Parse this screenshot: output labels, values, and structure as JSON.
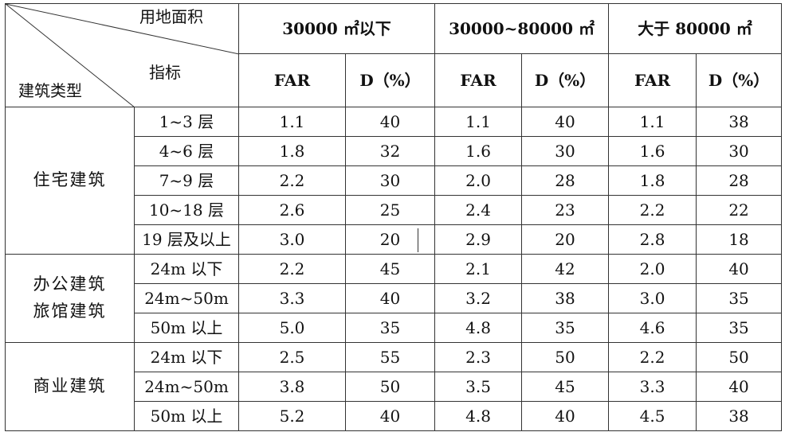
{
  "header": {
    "corner_top": "用地面积",
    "corner_mid": "指标",
    "corner_bottom": "建筑类型",
    "areas": [
      "30000 ㎡以下",
      "30000~80000 ㎡",
      "大于 80000 ㎡"
    ],
    "metrics": [
      "FAR",
      "D（%）"
    ]
  },
  "groups": [
    {
      "category_lines": [
        "住宅建筑"
      ],
      "rows": [
        {
          "sub": "1~3 层",
          "values": [
            "1.1",
            "40",
            "1.1",
            "40",
            "1.1",
            "38"
          ]
        },
        {
          "sub": "4~6 层",
          "values": [
            "1.8",
            "32",
            "1.6",
            "30",
            "1.6",
            "30"
          ]
        },
        {
          "sub": "7~9 层",
          "values": [
            "2.2",
            "30",
            "2.0",
            "28",
            "1.8",
            "28"
          ]
        },
        {
          "sub": "10~18 层",
          "values": [
            "2.6",
            "25",
            "2.4",
            "23",
            "2.2",
            "22"
          ]
        },
        {
          "sub": "19 层及以上",
          "values": [
            "3.0",
            "20",
            "2.9",
            "20",
            "2.8",
            "18"
          ]
        }
      ]
    },
    {
      "category_lines": [
        "办公建筑",
        "旅馆建筑"
      ],
      "rows": [
        {
          "sub": "24m 以下",
          "values": [
            "2.2",
            "45",
            "2.1",
            "42",
            "2.0",
            "40"
          ]
        },
        {
          "sub": "24m~50m",
          "values": [
            "3.3",
            "40",
            "3.2",
            "38",
            "3.0",
            "35"
          ]
        },
        {
          "sub": "50m 以上",
          "values": [
            "5.0",
            "35",
            "4.8",
            "35",
            "4.6",
            "35"
          ]
        }
      ]
    },
    {
      "category_lines": [
        "商业建筑"
      ],
      "rows": [
        {
          "sub": "24m 以下",
          "values": [
            "2.5",
            "55",
            "2.3",
            "50",
            "2.2",
            "50"
          ]
        },
        {
          "sub": "24m~50m",
          "values": [
            "3.8",
            "50",
            "3.5",
            "45",
            "3.3",
            "40"
          ]
        },
        {
          "sub": "50m 以上",
          "values": [
            "5.2",
            "40",
            "4.8",
            "40",
            "4.5",
            "38"
          ]
        }
      ]
    }
  ]
}
